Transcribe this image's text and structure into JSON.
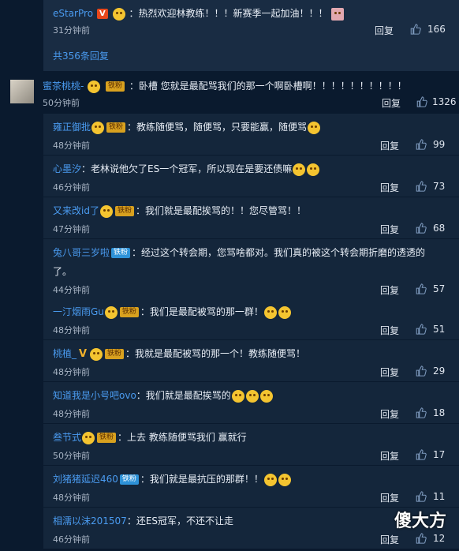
{
  "top_reply": {
    "user": "eStarPro",
    "text": "：热烈欢迎林教练！！！新赛季一起加油！！！",
    "time": "31分钟前",
    "reply": "回复",
    "likes": "166"
  },
  "more_replies": "共356条回复",
  "main_comment": {
    "user": "蜜茶桃桃-",
    "badge": "铁粉",
    "text": "：卧槽 您就是最配骂我们的那一个啊卧槽啊！！！！！！！！！！",
    "time": "50分钟前",
    "reply": "回复",
    "likes": "1326"
  },
  "replies": [
    {
      "user": "雍正御批",
      "badge": "铁粉",
      "badge_kind": "gold",
      "text": "：教练随便骂，随便骂，只要能赢，随便骂",
      "emojis": 1,
      "time": "48分钟前",
      "reply": "回复",
      "likes": "99"
    },
    {
      "user": "心墨汐",
      "badge": "",
      "badge_kind": "",
      "text": "：老林说他欠了ES一个冠军，所以现在是要还债嘛",
      "emojis": 2,
      "time": "46分钟前",
      "reply": "回复",
      "likes": "73"
    },
    {
      "user": "又来改id了",
      "badge": "铁粉",
      "badge_kind": "gold",
      "text": "：我们就是最配挨骂的！！您尽管骂！！",
      "emojis": 0,
      "time": "47分钟前",
      "reply": "回复",
      "likes": "68"
    },
    {
      "user": "兔八哥三岁啦",
      "badge": "铁粉",
      "badge_kind": "blue",
      "text": "：经过这个转会期，您骂啥都对。我们真的被这个转会期折磨的透透的",
      "text2": "了。",
      "emojis": 0,
      "time": "44分钟前",
      "reply": "回复",
      "likes": "57"
    },
    {
      "user": "一汀烟雨Gu",
      "badge": "铁粉",
      "badge_kind": "gold",
      "text": "：我们是最配被骂的那一群！",
      "emojis": 2,
      "time": "48分钟前",
      "reply": "回复",
      "likes": "51"
    },
    {
      "user": "桃植_",
      "badge": "铁粉",
      "badge_kind": "gold",
      "vmark": "V",
      "text": "：我就是最配被骂的那一个！教练随便骂！",
      "emojis": 0,
      "time": "48分钟前",
      "reply": "回复",
      "likes": "29"
    },
    {
      "user": "知道我是小号吧ovo",
      "badge": "",
      "badge_kind": "",
      "text": "：我们就是最配挨骂的",
      "emojis": 3,
      "time": "48分钟前",
      "reply": "回复",
      "likes": "18"
    },
    {
      "user": "叁节式",
      "badge": "铁粉",
      "badge_kind": "gold",
      "text": "：上去 教练随便骂我们 赢就行",
      "emojis": 0,
      "time": "50分钟前",
      "reply": "回复",
      "likes": "17"
    },
    {
      "user": "刘猪猪延迟460",
      "badge": "铁粉",
      "badge_kind": "blue",
      "text": "：我们就是最抗压的那群！！",
      "emojis": 2,
      "time": "48分钟前",
      "reply": "回复",
      "likes": "11"
    },
    {
      "user": "相濡以沫201507",
      "badge": "",
      "badge_kind": "",
      "text": "：还ES冠军，不还不让走",
      "emojis": 0,
      "time": "46分钟前",
      "reply": "回复",
      "likes": "12"
    }
  ],
  "watermark": "傻大方",
  "icons": {
    "like": "thumbs-up-icon"
  }
}
